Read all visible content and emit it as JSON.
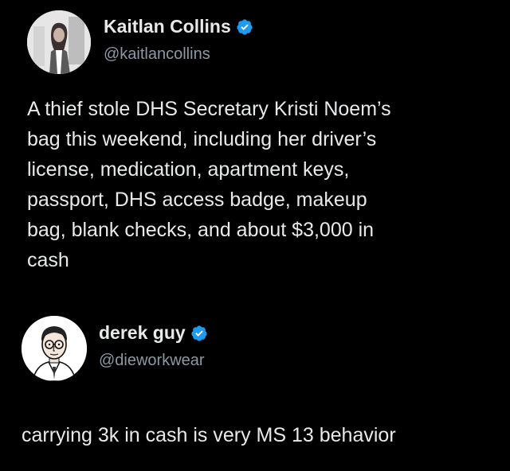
{
  "tweets": [
    {
      "display_name": "Kaitlan Collins",
      "handle": "@kaitlancollins",
      "verified_icon": "verified-badge-icon",
      "text_lines": [
        "A thief stole DHS Secretary Kristi Noem’s",
        "bag this weekend, including her driver’s",
        "license, medication, apartment keys,",
        "passport, DHS access badge, makeup",
        "bag, blank checks, and about $3,000 in",
        "cash"
      ]
    },
    {
      "display_name": "derek guy",
      "handle": "@dieworkwear",
      "verified_icon": "verified-badge-icon",
      "text_lines": [
        "carrying 3k in cash is very MS 13 behavior"
      ]
    }
  ],
  "colors": {
    "background": "#000000",
    "text": "#e7e9ea",
    "secondary_text": "#8b98a5",
    "verified_blue": "#1d9bf0"
  }
}
